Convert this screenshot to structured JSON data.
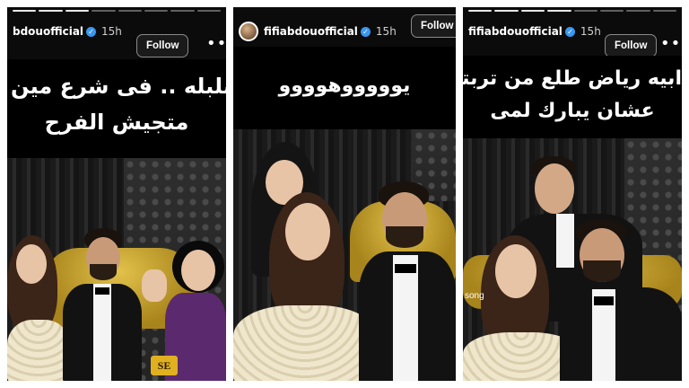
{
  "panels": [
    {
      "username": "bdouofficial",
      "time": "15h",
      "follow_label": "Follow",
      "more_label": "•••",
      "caption_lines": [
        "فين بلبله .. فى شرع مين",
        "متجيش الفرح"
      ],
      "watermark": "SE"
    },
    {
      "username": "fifiabdouofficial",
      "time": "15h",
      "follow_label": "Follow",
      "caption_lines": [
        "يوووووهوووو"
      ]
    },
    {
      "username": "fifiabdouofficial",
      "time": "15h",
      "follow_label": "Follow",
      "more_label": "•••",
      "caption_lines": [
        "ابيه رياض طلع من تربته",
        "عشان يبارك لمى"
      ],
      "song_tag": "song"
    }
  ],
  "verified_mark": "✓",
  "colors": {
    "follow_border": "#8a8a8a",
    "verified": "#3897f0",
    "sofa_gold": "#c9a22e"
  }
}
